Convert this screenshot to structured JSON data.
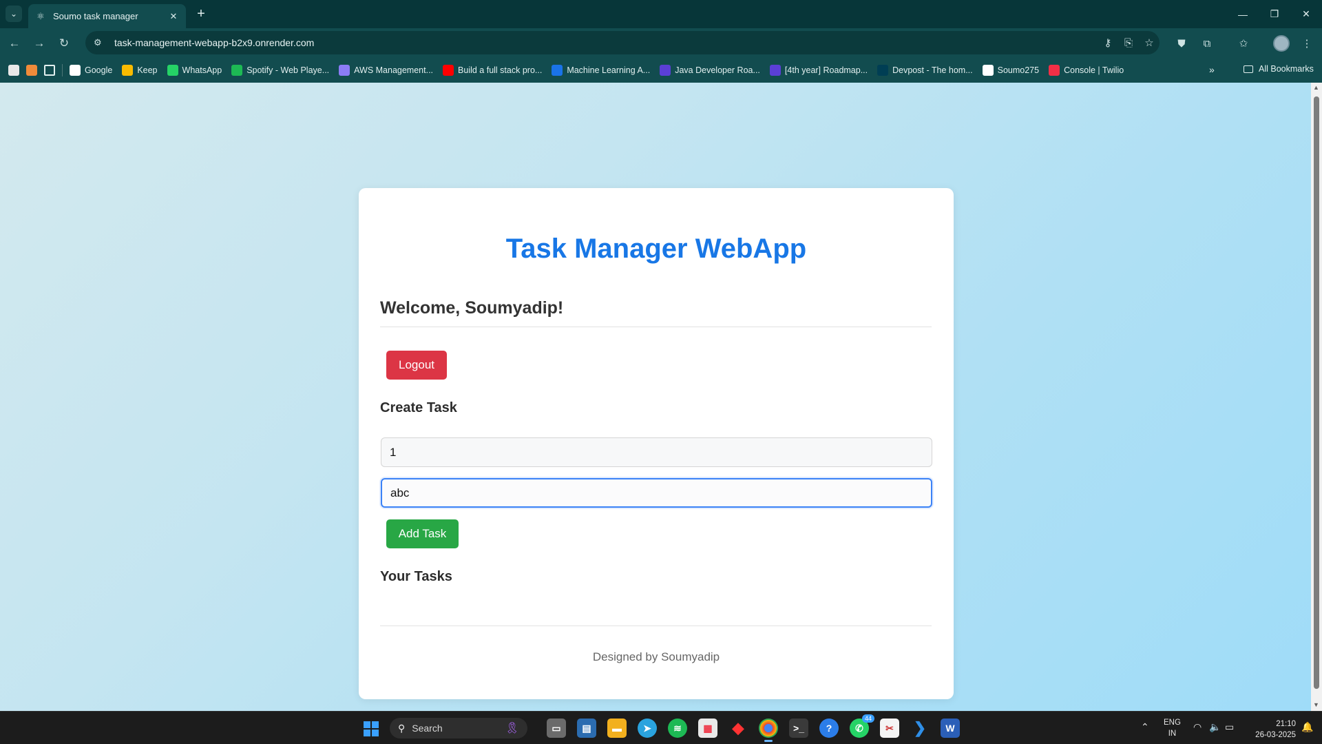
{
  "browser": {
    "tab_title": "Soumo task manager",
    "url": "task-management-webapp-b2x9.onrender.com",
    "bookmarks": [
      {
        "label": "Google",
        "icon": "google-icon",
        "color": "#ffffff"
      },
      {
        "label": "Keep",
        "icon": "keep-icon",
        "color": "#f9bb00"
      },
      {
        "label": "WhatsApp",
        "icon": "whatsapp-icon",
        "color": "#25d366"
      },
      {
        "label": "Spotify - Web Playe...",
        "icon": "spotify-icon",
        "color": "#1db954"
      },
      {
        "label": "AWS Management...",
        "icon": "aws-icon",
        "color": "#8b7cf6"
      },
      {
        "label": "Build a full stack pro...",
        "icon": "youtube-icon",
        "color": "#ff0000"
      },
      {
        "label": "Machine Learning A...",
        "icon": "s-icon",
        "color": "#1a73e8"
      },
      {
        "label": "Java Developer Roa...",
        "icon": "roadmap-icon",
        "color": "#5b3fd6"
      },
      {
        "label": "[4th year] Roadmap...",
        "icon": "roadmap-icon",
        "color": "#5b3fd6"
      },
      {
        "label": "Devpost - The hom...",
        "icon": "devpost-icon",
        "color": "#003e54"
      },
      {
        "label": "Soumo275",
        "icon": "github-icon",
        "color": "#ffffff"
      },
      {
        "label": "Console | Twilio",
        "icon": "twilio-icon",
        "color": "#f22f46"
      }
    ],
    "all_bookmarks": "All Bookmarks"
  },
  "app": {
    "title": "Task Manager WebApp",
    "welcome": "Welcome, Soumyadip!",
    "logout": "Logout",
    "create_heading": "Create Task",
    "task_title_value": "1",
    "task_desc_value": "abc",
    "add_task": "Add Task",
    "tasks_heading": "Your Tasks",
    "footer": "Designed by Soumyadip",
    "colors": {
      "title": "#1877e6",
      "logout": "#dc3545",
      "add": "#28a745",
      "focus": "#3b82f6"
    }
  },
  "taskbar": {
    "search_placeholder": "Search",
    "whatsapp_badge": "44",
    "lang_top": "ENG",
    "lang_bottom": "IN",
    "time": "21:10",
    "date": "26-03-2025"
  }
}
